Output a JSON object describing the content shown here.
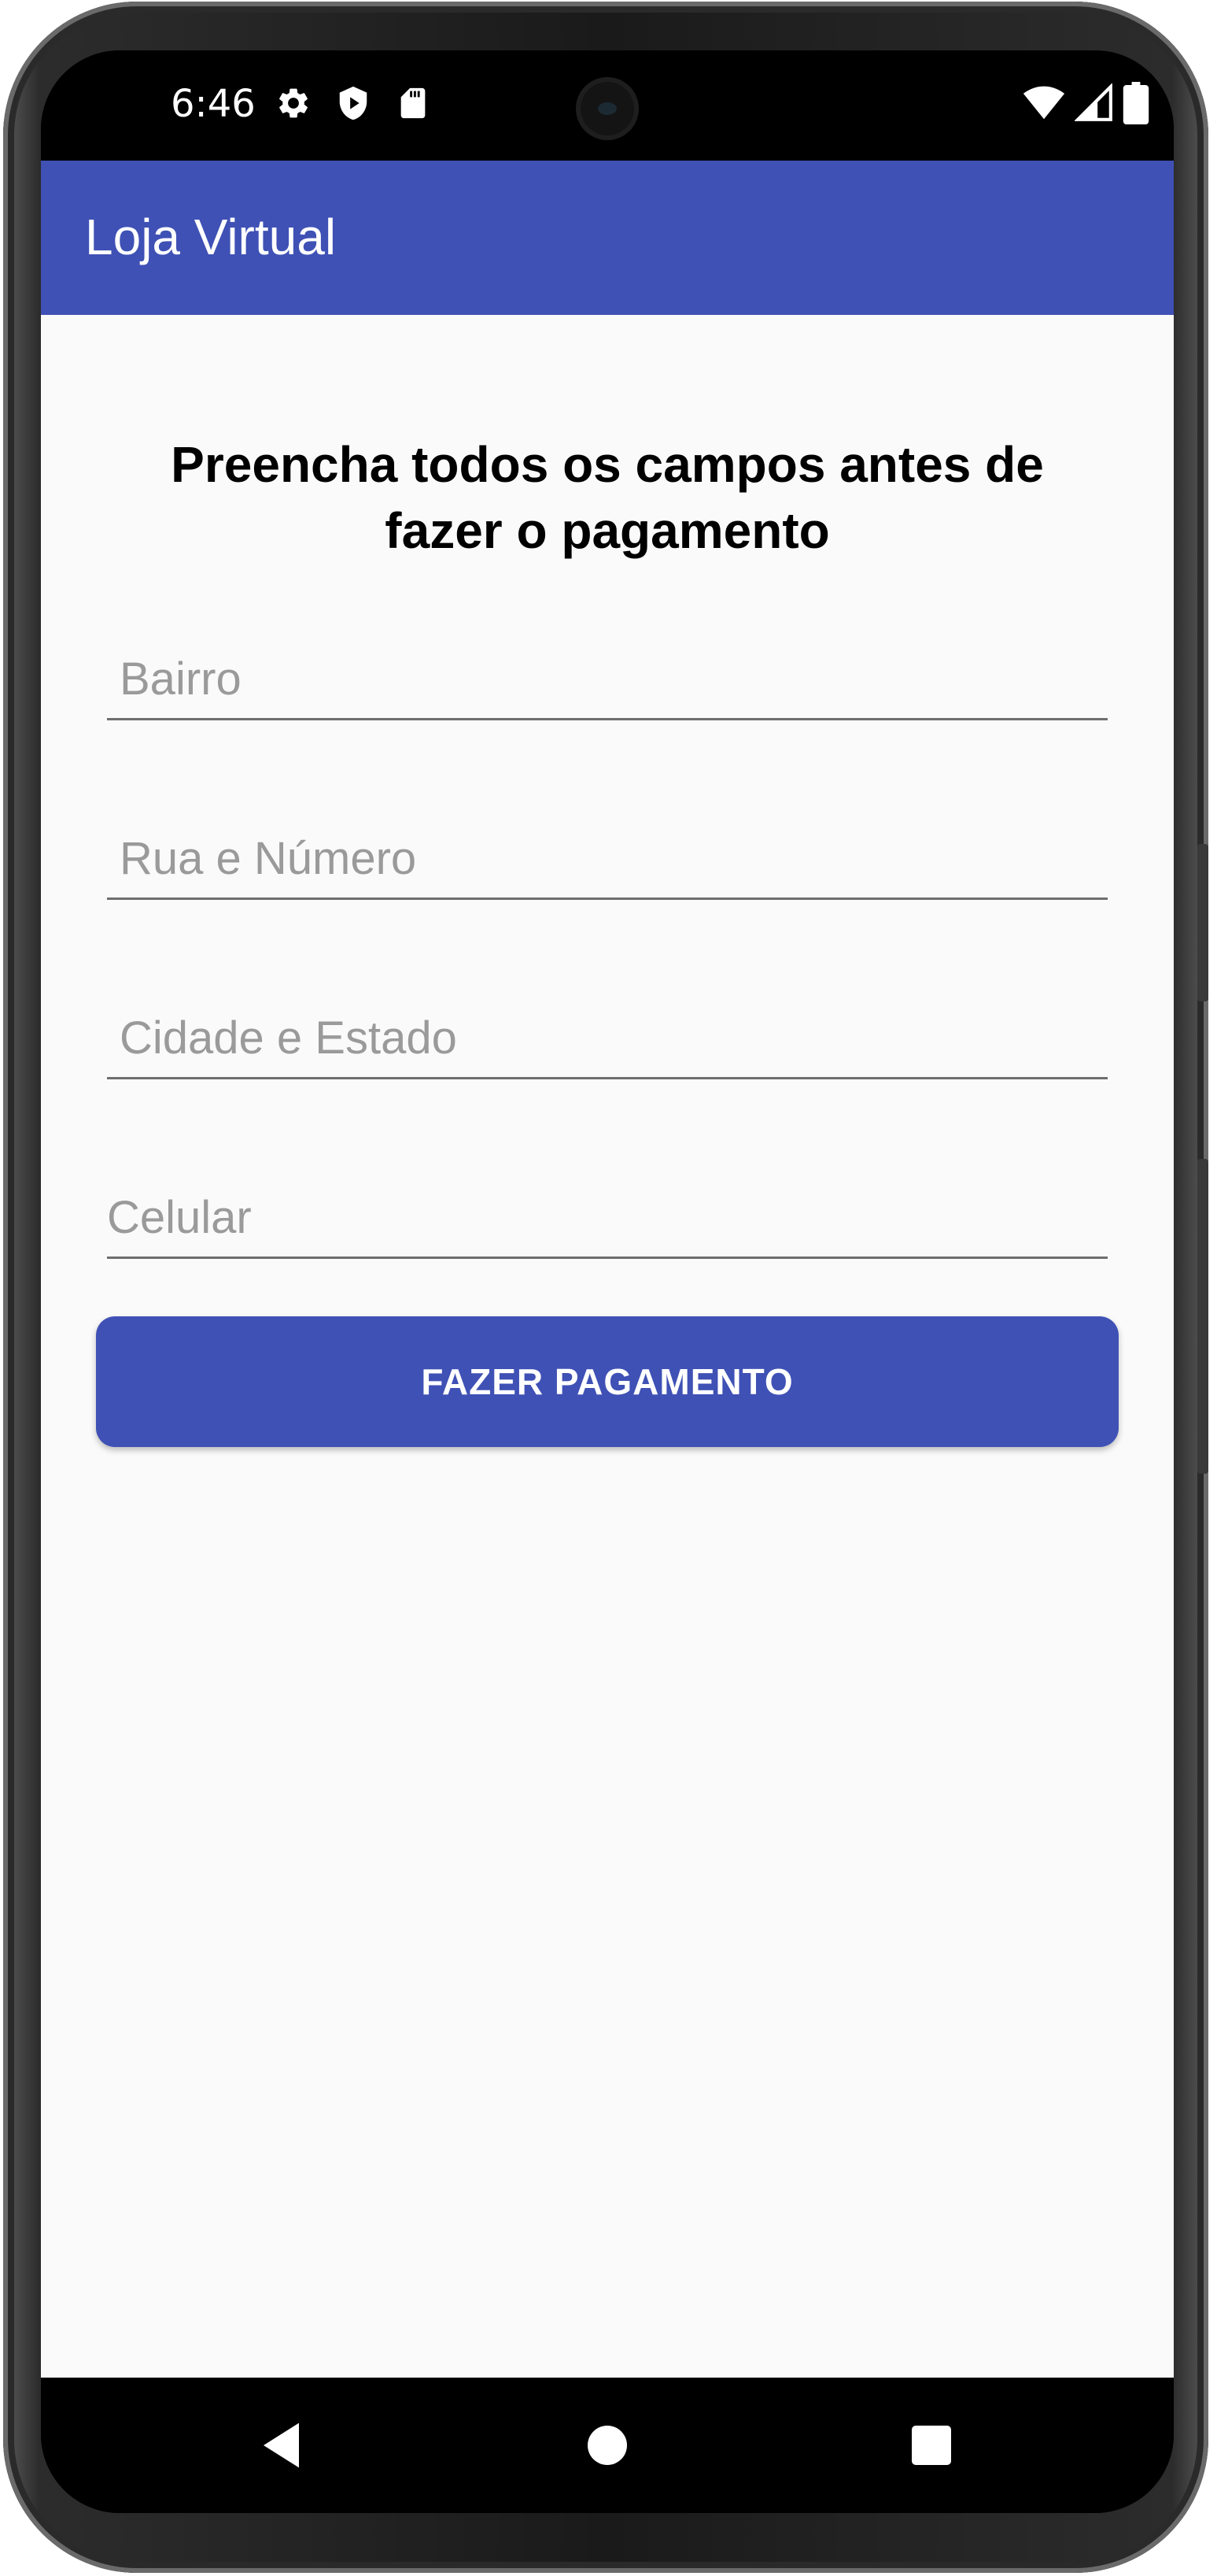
{
  "status_bar": {
    "time": "6:46",
    "left_icons": [
      "gear-icon",
      "shield-play-icon",
      "sd-card-icon"
    ],
    "right_icons": [
      "wifi-icon",
      "cell-signal-icon",
      "battery-icon"
    ]
  },
  "app_bar": {
    "title": "Loja Virtual",
    "color": "#3f51b5"
  },
  "form": {
    "heading": "Preencha todos os campos antes de fazer o pagamento",
    "fields": [
      {
        "placeholder": "Bairro",
        "value": ""
      },
      {
        "placeholder": "Rua e Número",
        "value": ""
      },
      {
        "placeholder": "Cidade e Estado",
        "value": ""
      },
      {
        "placeholder": "Celular",
        "value": ""
      }
    ],
    "submit_label": "FAZER PAGAMENTO"
  },
  "nav_bar": {
    "buttons": [
      "back-icon",
      "home-icon",
      "recents-icon"
    ]
  }
}
